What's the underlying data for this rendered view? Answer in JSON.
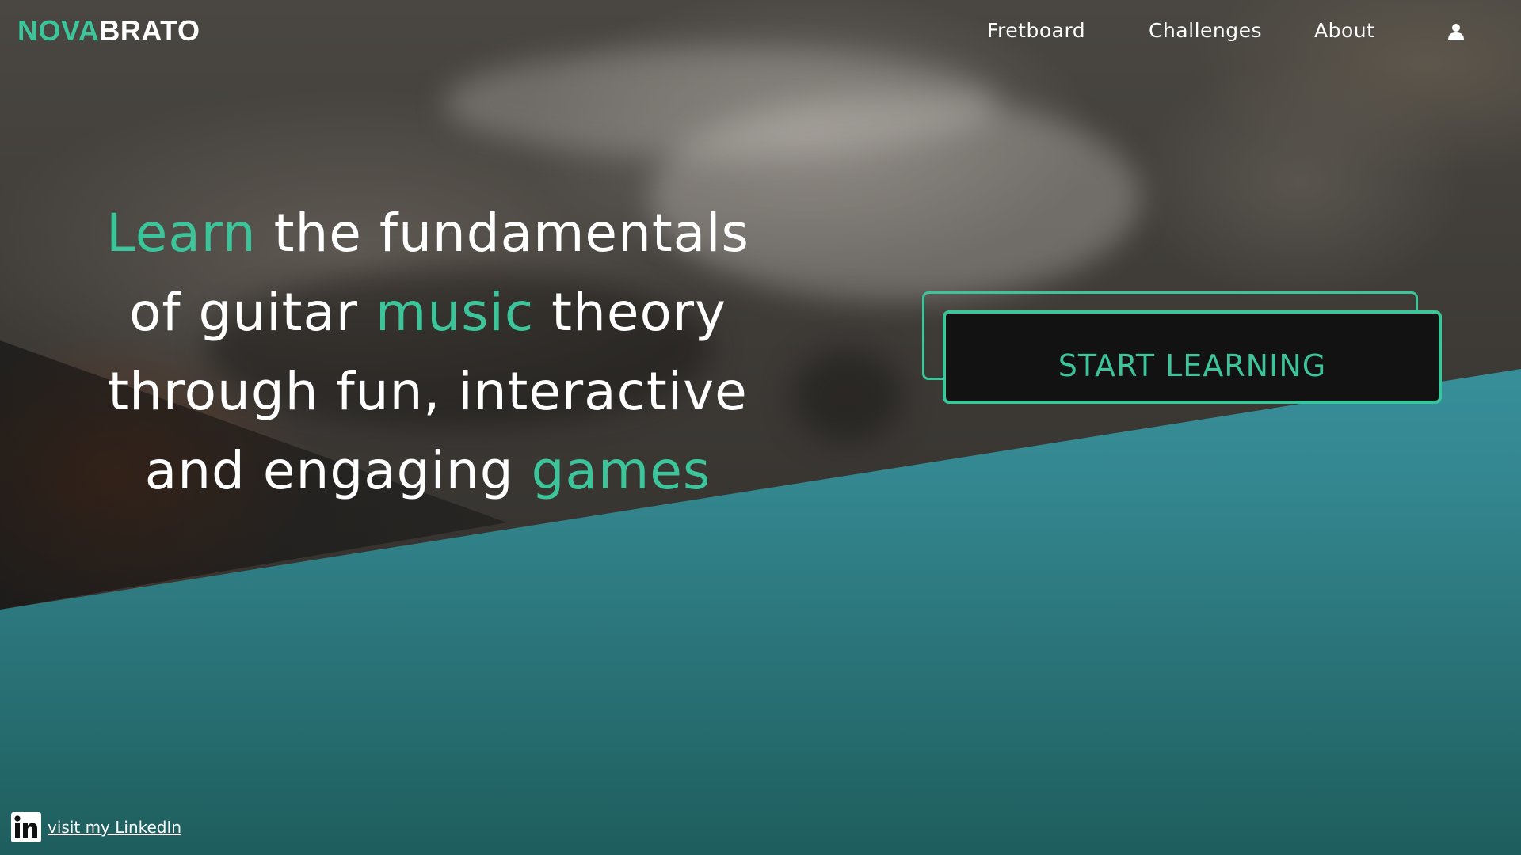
{
  "brand": {
    "part1": "NOVA",
    "part2": "BRATO"
  },
  "nav": {
    "items": [
      {
        "label": "Fretboard"
      },
      {
        "label": "Challenges"
      },
      {
        "label": "About"
      }
    ],
    "user_icon": "user-icon"
  },
  "hero": {
    "headline": {
      "line1_accent": "Learn",
      "line1_rest": " the fundamentals",
      "line2_start": "of guitar ",
      "line2_accent": "music",
      "line2_end": " theory",
      "line3": "through fun, interactive",
      "line4_start": "and engaging ",
      "line4_accent": "games"
    },
    "cta_label": "START LEARNING"
  },
  "footer": {
    "linkedin_label": "visit my LinkedIn",
    "linkedin_icon": "linkedin-icon"
  },
  "colors": {
    "accent": "#3cc49a",
    "teal_panel": "#42aabe",
    "button_bg": "#121212"
  }
}
